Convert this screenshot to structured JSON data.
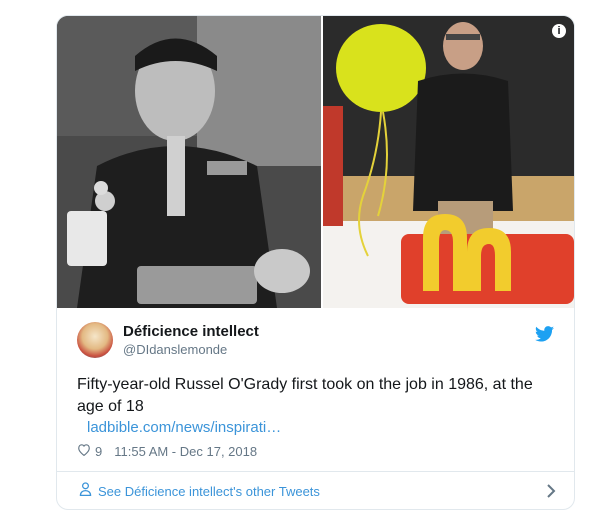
{
  "tweet": {
    "display_name": "Déficience intellect",
    "handle": "@DIdanslemonde",
    "text": "Fifty-year-old Russel O'Grady first took on the job in 1986, at the age of 18",
    "link": "ladbible.com/news/inspirati…",
    "likes": "9",
    "timestamp": "11:55 AM - Dec 17, 2018"
  },
  "footer": {
    "label": "See Déficience intellect's other Tweets"
  },
  "icons": {
    "info": "info-icon",
    "twitter": "twitter-bird-icon",
    "heart": "heart-icon",
    "person": "person-icon",
    "chevron": "chevron-right-icon"
  },
  "colors": {
    "link": "#3b94d9",
    "twitter_blue": "#1da1f2",
    "muted": "#657786",
    "border": "#e1e8ed"
  }
}
